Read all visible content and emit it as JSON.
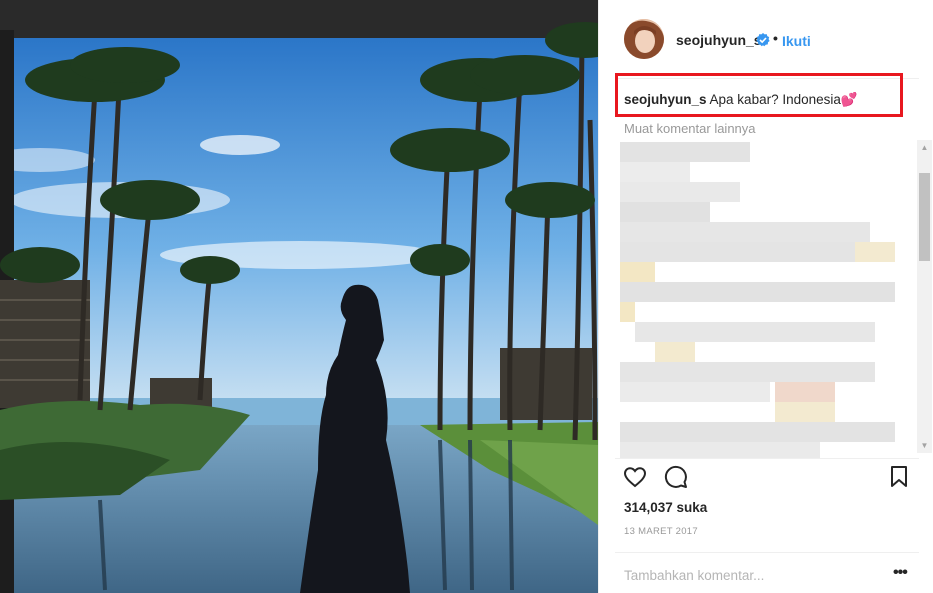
{
  "post": {
    "username": "seojuhyun_s",
    "dot": "•",
    "follow_label": "Ikuti",
    "caption_username": "seojuhyun_s",
    "caption_text": " Apa kabar? Indonesia💕",
    "load_more_label": "Muat komentar lainnya",
    "likes": "314,037 suka",
    "date": "13 MARET 2017",
    "comment_placeholder": "Tambahkan komentar...",
    "more_label": "•••"
  },
  "colors": {
    "link": "#3897f0",
    "highlight": "#e8171f",
    "muted": "#999999"
  },
  "icons": {
    "like": "heart-icon",
    "comment": "speech-bubble-icon",
    "save": "bookmark-icon",
    "verified": "verified-badge-icon"
  }
}
